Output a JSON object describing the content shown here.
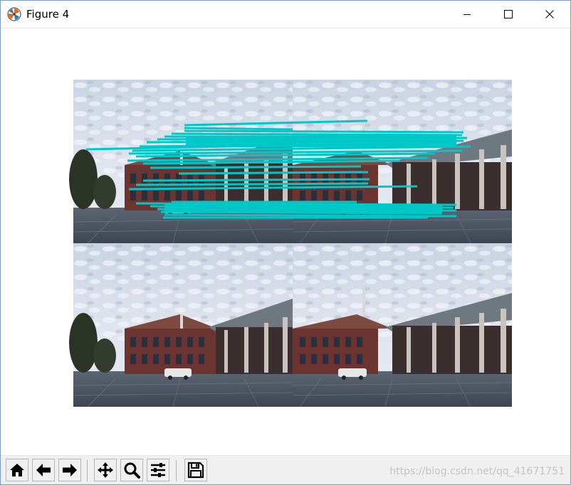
{
  "window": {
    "title": "Figure 4",
    "icons": {
      "app": "matplotlib-logo-icon",
      "minimize": "minimize-icon",
      "maximize": "maximize-icon",
      "close": "close-icon"
    }
  },
  "figure": {
    "image_description": "2x2 grid of building photos; top row overlaid with cyan feature-match lines",
    "match_line_color": "#00c8c8"
  },
  "toolbar": {
    "buttons": [
      {
        "id": "home",
        "icon": "home-icon"
      },
      {
        "id": "back",
        "icon": "arrow-left-icon"
      },
      {
        "id": "forward",
        "icon": "arrow-right-icon"
      },
      {
        "id": "pan",
        "icon": "move-icon"
      },
      {
        "id": "zoom",
        "icon": "zoom-icon"
      },
      {
        "id": "configure",
        "icon": "sliders-icon"
      },
      {
        "id": "save",
        "icon": "save-icon"
      }
    ],
    "watermark": "https://blog.csdn.net/qq_41671751"
  }
}
